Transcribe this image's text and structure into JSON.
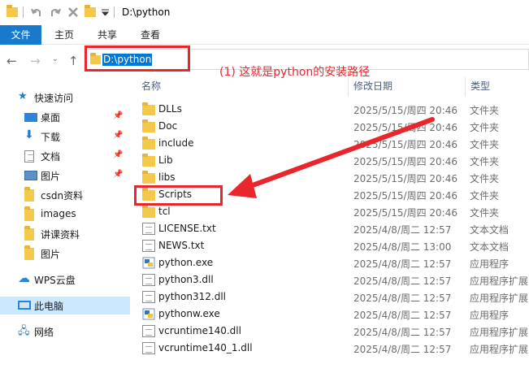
{
  "window": {
    "title": "D:\\python"
  },
  "ribbon": {
    "tabs": [
      "文件",
      "主页",
      "共享",
      "查看"
    ]
  },
  "address": {
    "path": "D:\\python"
  },
  "annotation": {
    "note": "(1) 这就是python的安装路径"
  },
  "columns": {
    "name": "名称",
    "date": "修改日期",
    "type": "类型"
  },
  "sidebar": {
    "items": [
      {
        "label": "快速访问",
        "icon": "star-icon"
      },
      {
        "label": "桌面",
        "icon": "desktop-icon",
        "pinned": true
      },
      {
        "label": "下载",
        "icon": "download-icon",
        "pinned": true
      },
      {
        "label": "文档",
        "icon": "document-icon",
        "pinned": true
      },
      {
        "label": "图片",
        "icon": "picture-icon",
        "pinned": true
      },
      {
        "label": "csdn资料",
        "icon": "folder-icon"
      },
      {
        "label": "images",
        "icon": "folder-icon"
      },
      {
        "label": "讲课资料",
        "icon": "folder-icon"
      },
      {
        "label": "图片",
        "icon": "folder-icon"
      },
      {
        "label": "WPS云盘",
        "icon": "cloud-icon"
      },
      {
        "label": "此电脑",
        "icon": "computer-icon",
        "selected": true
      },
      {
        "label": "网络",
        "icon": "network-icon"
      }
    ]
  },
  "files": [
    {
      "name": "DLLs",
      "date": "2025/5/15/周四 20:46",
      "type": "文件夹",
      "icon": "folder"
    },
    {
      "name": "Doc",
      "date": "2025/5/15/周四 20:46",
      "type": "文件夹",
      "icon": "folder"
    },
    {
      "name": "include",
      "date": "2025/5/15/周四 20:46",
      "type": "文件夹",
      "icon": "folder"
    },
    {
      "name": "Lib",
      "date": "2025/5/15/周四 20:46",
      "type": "文件夹",
      "icon": "folder"
    },
    {
      "name": "libs",
      "date": "2025/5/15/周四 20:46",
      "type": "文件夹",
      "icon": "folder"
    },
    {
      "name": "Scripts",
      "date": "2025/5/15/周四 20:46",
      "type": "文件夹",
      "icon": "folder"
    },
    {
      "name": "tcl",
      "date": "2025/5/15/周四 20:46",
      "type": "文件夹",
      "icon": "folder"
    },
    {
      "name": "LICENSE.txt",
      "date": "2025/4/8/周二 12:57",
      "type": "文本文档",
      "icon": "text"
    },
    {
      "name": "NEWS.txt",
      "date": "2025/4/8/周二 13:00",
      "type": "文本文档",
      "icon": "text"
    },
    {
      "name": "python.exe",
      "date": "2025/4/8/周二 12:57",
      "type": "应用程序",
      "icon": "python"
    },
    {
      "name": "python3.dll",
      "date": "2025/4/8/周二 12:57",
      "type": "应用程序扩展",
      "icon": "dll"
    },
    {
      "name": "python312.dll",
      "date": "2025/4/8/周二 12:57",
      "type": "应用程序扩展",
      "icon": "dll"
    },
    {
      "name": "pythonw.exe",
      "date": "2025/4/8/周二 12:57",
      "type": "应用程序",
      "icon": "python"
    },
    {
      "name": "vcruntime140.dll",
      "date": "2025/4/8/周二 12:57",
      "type": "应用程序扩展",
      "icon": "dll"
    },
    {
      "name": "vcruntime140_1.dll",
      "date": "2025/4/8/周二 12:57",
      "type": "应用程序扩展",
      "icon": "dll"
    }
  ],
  "colors": {
    "accent": "#1979ca",
    "selection": "#0078d7",
    "annotation": "#e8262c",
    "folder": "#f4c84a"
  }
}
